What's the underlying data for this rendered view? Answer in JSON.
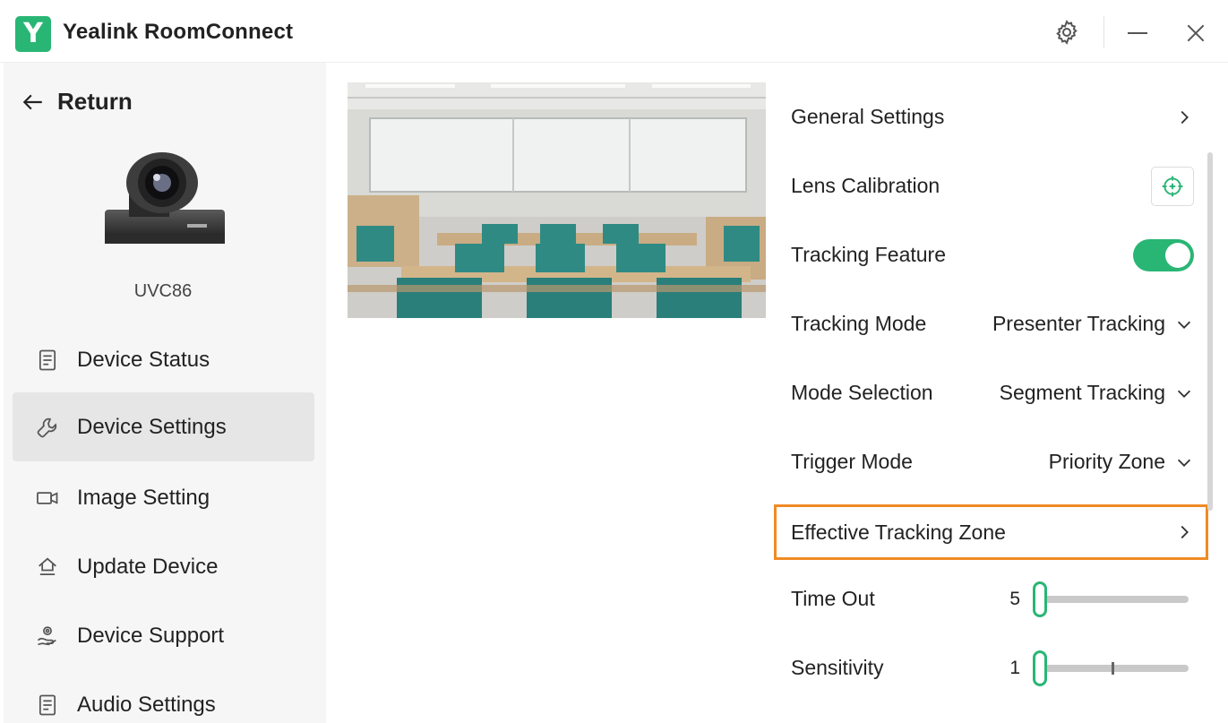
{
  "app": {
    "logo_letter": "Y",
    "title": "Yealink RoomConnect"
  },
  "sidebar": {
    "return_label": "Return",
    "device_name": "UVC86",
    "items": [
      {
        "label": "Device Status",
        "icon": "document-icon"
      },
      {
        "label": "Device Settings",
        "icon": "wrench-icon",
        "active": true
      },
      {
        "label": "Image Setting",
        "icon": "video-camera-icon"
      },
      {
        "label": "Update Device",
        "icon": "upload-home-icon"
      },
      {
        "label": "Device Support",
        "icon": "support-hand-icon"
      },
      {
        "label": "Audio Settings",
        "icon": "document-icon"
      }
    ]
  },
  "settings": {
    "general": "General Settings",
    "lens_calibration": "Lens Calibration",
    "tracking_feature": "Tracking Feature",
    "tracking_feature_on": true,
    "tracking_mode": {
      "label": "Tracking Mode",
      "value": "Presenter Tracking"
    },
    "mode_selection": {
      "label": "Mode Selection",
      "value": "Segment Tracking"
    },
    "trigger_mode": {
      "label": "Trigger Mode",
      "value": "Priority Zone"
    },
    "effective_zone": "Effective Tracking Zone",
    "time_out": {
      "label": "Time Out",
      "value": "5"
    },
    "sensitivity": {
      "label": "Sensitivity",
      "value": "1"
    }
  },
  "colors": {
    "accent": "#29b675",
    "highlight": "#f08a24"
  }
}
